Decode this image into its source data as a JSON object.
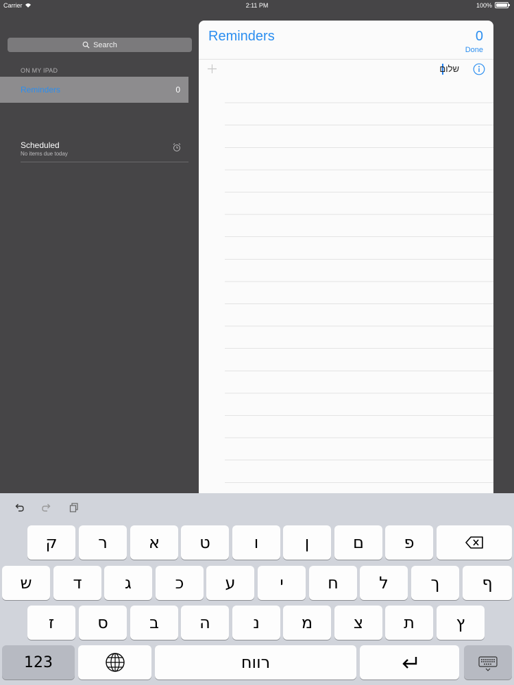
{
  "status_bar": {
    "carrier": "Carrier",
    "time": "2:11 PM",
    "battery": "100%"
  },
  "sidebar": {
    "search_placeholder": "Search",
    "section_header": "ON MY IPAD",
    "lists": [
      {
        "name": "Reminders",
        "count": "0",
        "selected": true
      }
    ],
    "scheduled": {
      "title": "Scheduled",
      "subtitle": "No items due today",
      "icon": "alarm-clock-icon"
    }
  },
  "reminders_panel": {
    "title": "Reminders",
    "count": "0",
    "done_label": "Done",
    "entry_text": "שלום",
    "accent_color": "#2b8ef0"
  },
  "keyboard": {
    "toolbar": [
      "undo-icon",
      "redo-icon",
      "paste-icon"
    ],
    "row1": [
      "ק",
      "ר",
      "א",
      "ט",
      "ו",
      "ן",
      "ם",
      "פ"
    ],
    "row2": [
      "ש",
      "ד",
      "ג",
      "כ",
      "ע",
      "י",
      "ח",
      "ל",
      "ך",
      "ף"
    ],
    "row3": [
      "ז",
      "ס",
      "ב",
      "ה",
      "נ",
      "מ",
      "צ",
      "ת",
      "ץ"
    ],
    "numbers_label": "123",
    "space_label": "רווח",
    "icons": {
      "backspace": "backspace-icon",
      "globe": "globe-icon",
      "return": "return-icon",
      "dismiss": "keyboard-dismiss-icon"
    }
  }
}
